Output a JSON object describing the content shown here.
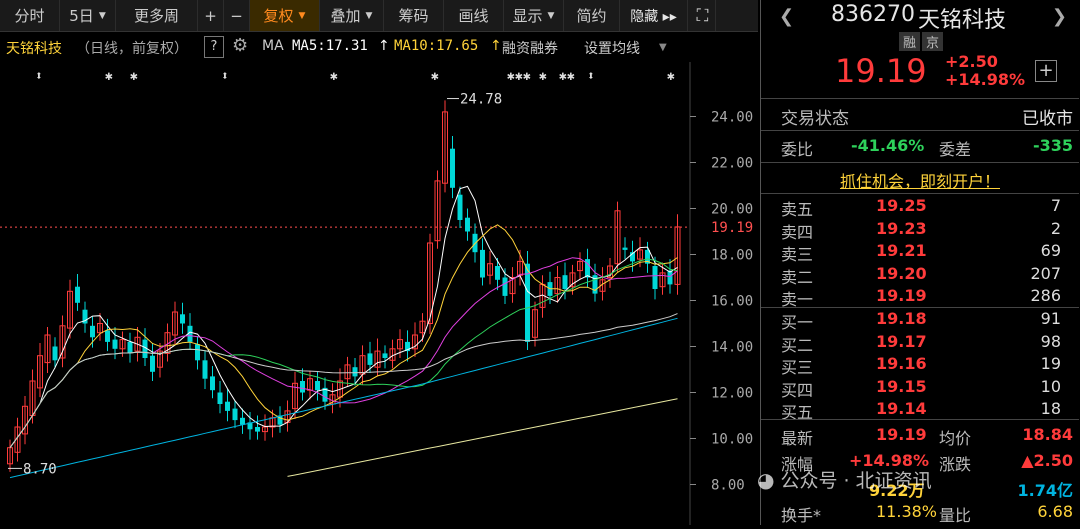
{
  "toolbar": {
    "items": [
      {
        "label": "分时",
        "dropdown": false,
        "active": false
      },
      {
        "label": "5日",
        "dropdown": true,
        "active": false
      },
      {
        "label": "更多周",
        "dropdown": false,
        "active": false
      },
      {
        "label": "+",
        "dropdown": false,
        "active": false
      },
      {
        "label": "−",
        "dropdown": false,
        "active": false
      },
      {
        "label": "复权",
        "dropdown": true,
        "active": true
      },
      {
        "label": "叠加",
        "dropdown": true,
        "active": false
      },
      {
        "label": "筹码",
        "dropdown": false,
        "active": false
      },
      {
        "label": "画线",
        "dropdown": false,
        "active": false
      },
      {
        "label": "显示",
        "dropdown": true,
        "active": false
      },
      {
        "label": "简约",
        "dropdown": false,
        "active": false
      },
      {
        "label": "隐藏 ▸▸",
        "dropdown": false,
        "active": false
      }
    ],
    "expand_icon": "expand-icon"
  },
  "infobar": {
    "name": "天铭科技",
    "period": "（日线，前复权）",
    "help": "?",
    "settings_icon": "gear-icon",
    "ma_label": "MA",
    "ma5": "MA5:17.31",
    "ma10": "MA10:17.65",
    "margin": "融资融券",
    "set_ma": "设置均线",
    "colors": {
      "name": "#ffd33a",
      "ma5": "#ffffff",
      "ma10": "#ffd33a",
      "label": "#cccccc"
    }
  },
  "chart": {
    "y_ticks": [
      "24.00",
      "22.00",
      "20.00",
      "18.00",
      "16.00",
      "14.00",
      "12.00",
      "10.00",
      "8.00"
    ],
    "current_price_label": "19.19",
    "high_annotation": "24.78",
    "low_annotation": "8.70",
    "up_color": "#ff3b3b",
    "down_color": "#00d8d8",
    "ma_colors": {
      "ma5": "#ffffff",
      "ma10": "#ffd33a",
      "ma20": "#e040e0",
      "ma30": "#2ed15b",
      "ma60": "#cccccc",
      "ma120": "#00b4e0",
      "ma250": "#e8e8a0"
    }
  },
  "panel": {
    "code": "836270",
    "name": "天铭科技",
    "tags": [
      "融",
      "京"
    ],
    "price": "19.19",
    "change": "+2.50",
    "change_pct": "+14.98%",
    "status_label": "交易状态",
    "status_value": "已收市",
    "weibi_label": "委比",
    "weibi_value": "-41.46%",
    "weicha_label": "委差",
    "weicha_value": "-335",
    "promo": "抓住机会，即刻开户！",
    "asks": [
      {
        "label": "卖五",
        "price": "19.25",
        "vol": "7"
      },
      {
        "label": "卖四",
        "price": "19.23",
        "vol": "2"
      },
      {
        "label": "卖三",
        "price": "19.21",
        "vol": "69"
      },
      {
        "label": "卖二",
        "price": "19.20",
        "vol": "207"
      },
      {
        "label": "卖一",
        "price": "19.19",
        "vol": "286"
      }
    ],
    "bids": [
      {
        "label": "买一",
        "price": "19.18",
        "vol": "91"
      },
      {
        "label": "买二",
        "price": "19.17",
        "vol": "98"
      },
      {
        "label": "买三",
        "price": "19.16",
        "vol": "19"
      },
      {
        "label": "买四",
        "price": "19.15",
        "vol": "10"
      },
      {
        "label": "买五",
        "price": "19.14",
        "vol": "18"
      }
    ],
    "stats": {
      "latest_label": "最新",
      "latest": "19.19",
      "avg_label": "均价",
      "avg": "18.84",
      "chg_pct_label": "涨幅",
      "chg_pct": "+14.98%",
      "chg_label": "涨跌",
      "chg": "▲2.50",
      "vol_value": "9.22万",
      "amount_value": "1.74亿",
      "turnover_label": "换手*",
      "turnover": "11.38%",
      "vol_ratio_label": "量比",
      "vol_ratio": "6.68"
    },
    "watermark": "公众号 · 北证资讯"
  }
}
